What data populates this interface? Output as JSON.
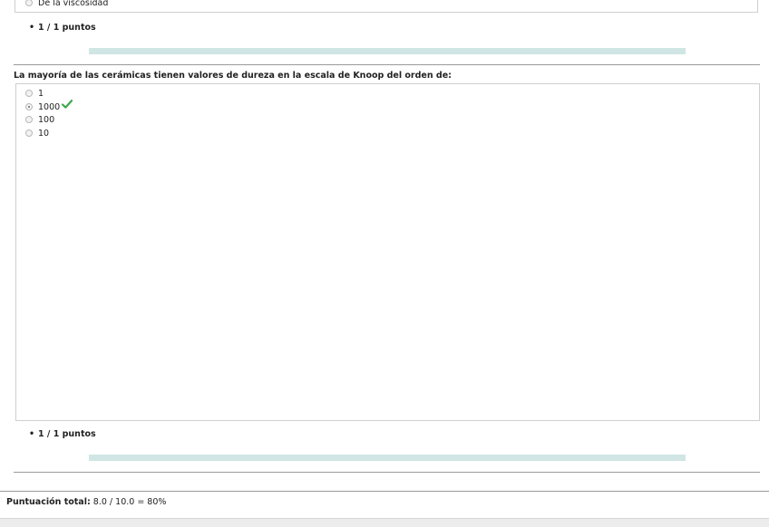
{
  "previous_question": {
    "last_option_label": "De la viscosidad",
    "score_label": "1 / 1 puntos",
    "progress_fraction": 1.0
  },
  "question": {
    "text": "La mayoría de las cerámicas tienen valores de dureza en la escala de Knoop del orden de:",
    "options": [
      {
        "label": "1",
        "selected": false
      },
      {
        "label": "1000",
        "selected": true,
        "correct_mark": "check-icon"
      },
      {
        "label": "100",
        "selected": false
      },
      {
        "label": "10",
        "selected": false
      }
    ],
    "score_label": "1 / 1 puntos",
    "progress_fraction": 1.0
  },
  "total": {
    "label": "Puntuación total:",
    "value": "8.0 / 10.0 = 80%"
  },
  "colors": {
    "progress": "#cfe6e4",
    "check": "#3aa94a",
    "rule": "#9a9a9a"
  }
}
